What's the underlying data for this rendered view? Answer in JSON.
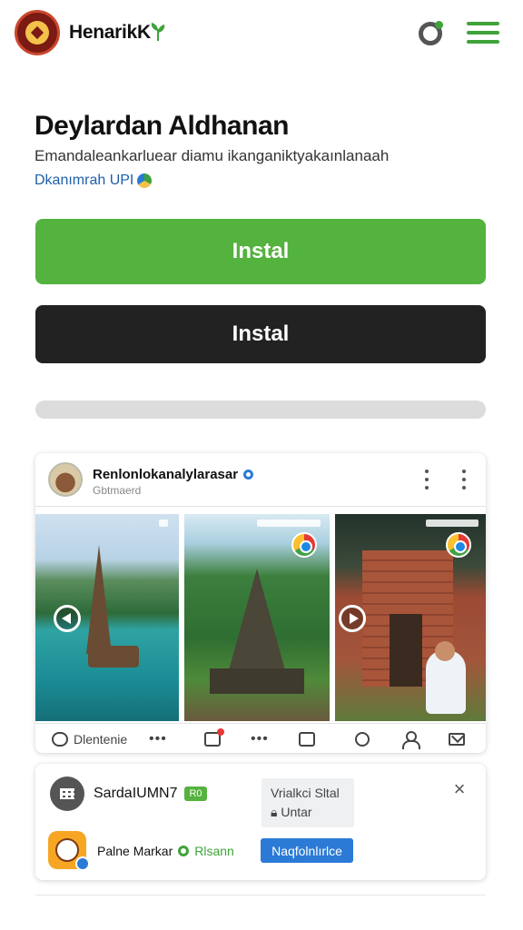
{
  "header": {
    "brand": "HenarikK",
    "logo_icon": "temple-emblem-logo",
    "leaf_icon": "leaf-icon",
    "sync_icon": "sync-icon",
    "menu_icon": "hamburger-menu-icon"
  },
  "app": {
    "title": "Deylardan Aldhanan",
    "subtitle": "Emandaleankarluear diamu ikanganiktyakaınlanaah",
    "developer": "Dkanımrah UPI"
  },
  "buttons": {
    "primary_label": "Instal",
    "secondary_label": "Instal"
  },
  "progress": {
    "fraction": 1.0
  },
  "post": {
    "author": "Renlonlokanalylarasar",
    "author_sub": "Gbtmaerd",
    "screenshots": [
      "lake-pagoda",
      "jungle-temple",
      "red-temple-gate"
    ],
    "toolbar": {
      "comment_label": "Dlentenie",
      "items": [
        "chat-bubble-icon",
        "more-dots-icon",
        "message-box-icon",
        "more-dots-icon",
        "document-icon",
        "search-icon",
        "user-icon",
        "mail-icon"
      ]
    }
  },
  "banner": {
    "title": "SardaIUMN7",
    "tag": "R0",
    "side_line1": "Vrialkci Sltal",
    "side_line2": "Untar",
    "close": "×",
    "app_name": "Palne Markar",
    "app_status": "Rlsann",
    "action_label": "Naqfolnlırlce"
  },
  "colors": {
    "accent_green": "#54b23e",
    "dark_button": "#222222",
    "link_blue": "#1f5fa8",
    "action_blue": "#2b7bd6"
  }
}
